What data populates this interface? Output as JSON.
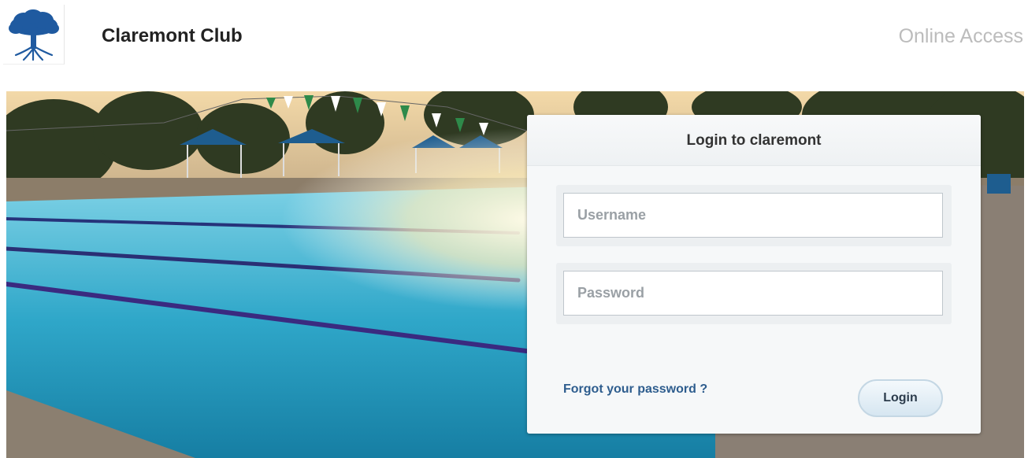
{
  "header": {
    "brand_name": "Claremont Club",
    "online_access": "Online Access"
  },
  "login": {
    "title": "Login to claremont",
    "username_placeholder": "Username",
    "password_placeholder": "Password",
    "forgot_link": "Forgot your password ?",
    "login_button": "Login"
  },
  "colors": {
    "brand_blue": "#1f5aa0",
    "link_blue": "#2e5d8e",
    "muted_gray": "#bcbcbc"
  },
  "icons": {
    "logo": "oak-tree-logo"
  }
}
